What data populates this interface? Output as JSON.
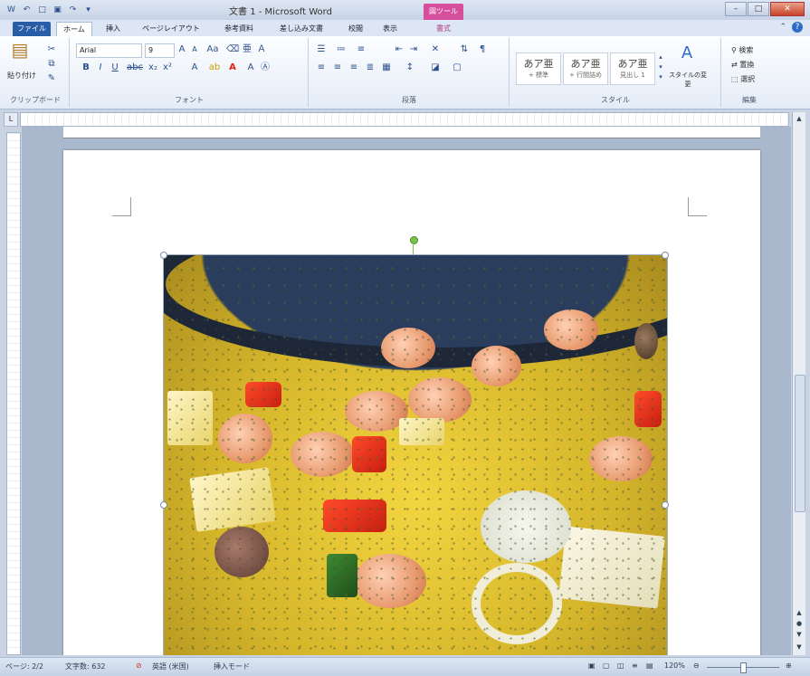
{
  "window": {
    "title": "文書 1 - Microsoft Word",
    "context_tab": "図ツール"
  },
  "tabs": [
    {
      "label": "ファイル"
    },
    {
      "label": "ホーム"
    },
    {
      "label": "挿入"
    },
    {
      "label": "ページレイアウト"
    },
    {
      "label": "参考資料"
    },
    {
      "label": "差し込み文書"
    },
    {
      "label": "校閲"
    },
    {
      "label": "表示"
    },
    {
      "label": "書式"
    }
  ],
  "ribbon": {
    "clipboard": {
      "paste_label": "貼り付け",
      "group_label": "クリップボード"
    },
    "font": {
      "font_name": "Arial",
      "font_size": "9",
      "group_label": "フォント"
    },
    "paragraph": {
      "group_label": "段落"
    },
    "styles": {
      "items": [
        {
          "preview": "あア亜",
          "name": "+ 標準"
        },
        {
          "preview": "あア亜",
          "name": "+ 行間詰め"
        },
        {
          "preview": "あア亜",
          "name": "見出し 1"
        }
      ],
      "change_label": "スタイルの変更",
      "group_label": "スタイル"
    },
    "editing": {
      "find": "検索",
      "replace": "置換",
      "select": "選択",
      "group_label": "編集"
    }
  },
  "status": {
    "page": "ページ: 2/2",
    "words": "文字数: 632",
    "language": "英語 (米国)",
    "mode": "挿入モード",
    "zoom": "120%"
  },
  "icons": [
    "paste-icon",
    "cut-icon",
    "copy-icon",
    "format-painter-icon",
    "bold-icon",
    "italic-icon",
    "underline-icon",
    "font-color-icon",
    "styles-change-icon",
    "find-icon",
    "replace-icon",
    "select-icon"
  ],
  "colors": {
    "file_tab": "#2a5da8",
    "context_tab": "#d64f9c"
  }
}
